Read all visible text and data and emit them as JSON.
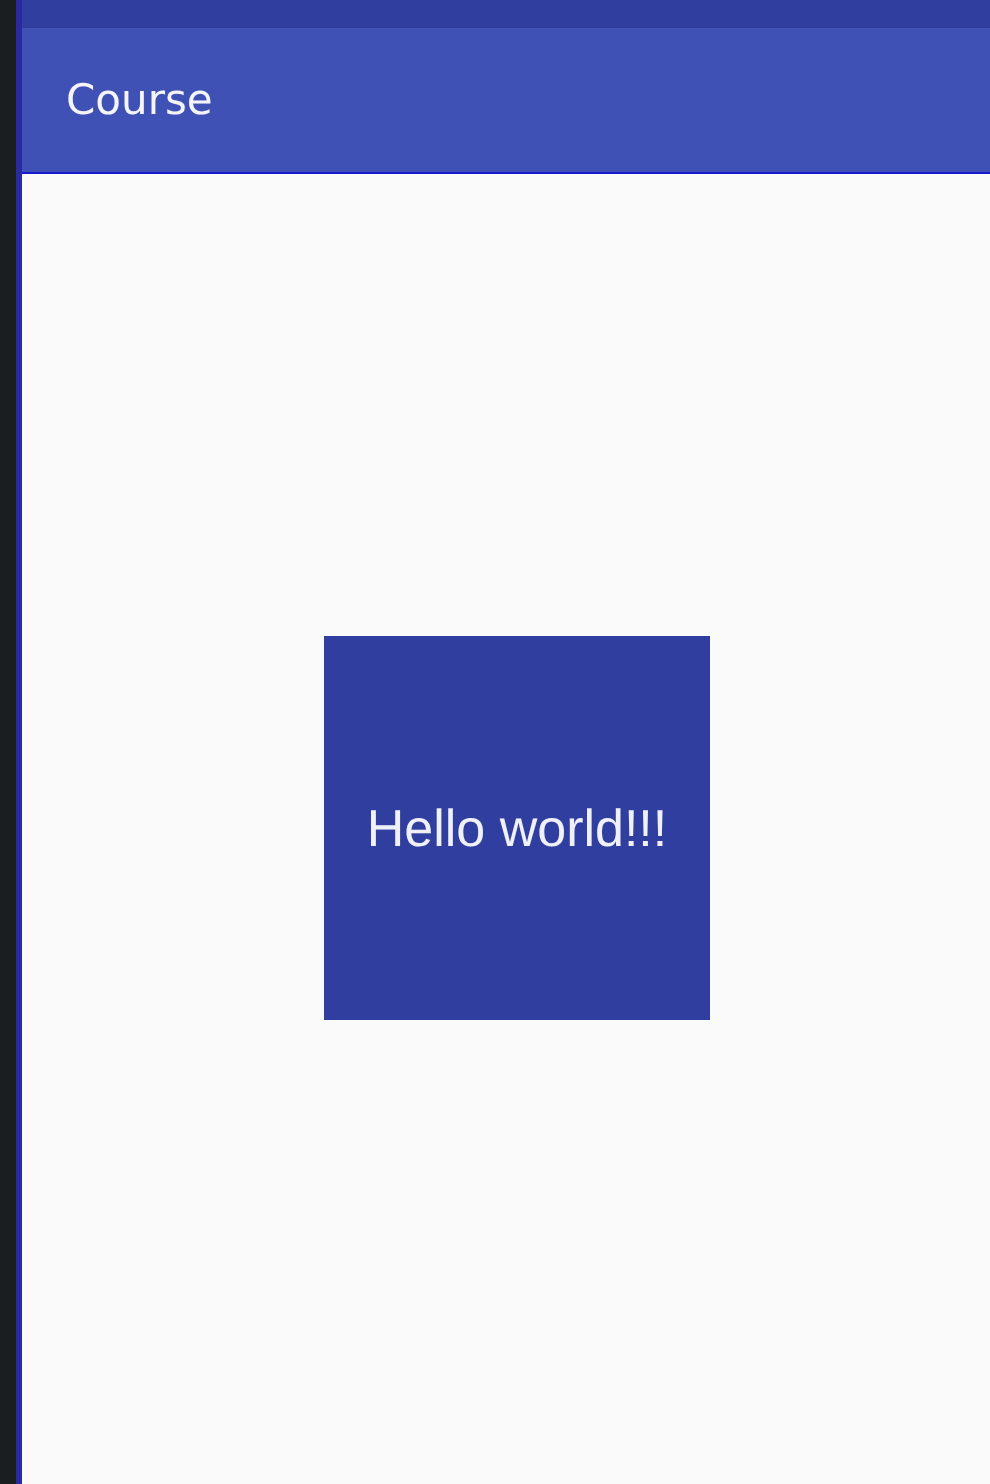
{
  "app_bar": {
    "title": "Course"
  },
  "content": {
    "box_text": "Hello world!!!"
  }
}
